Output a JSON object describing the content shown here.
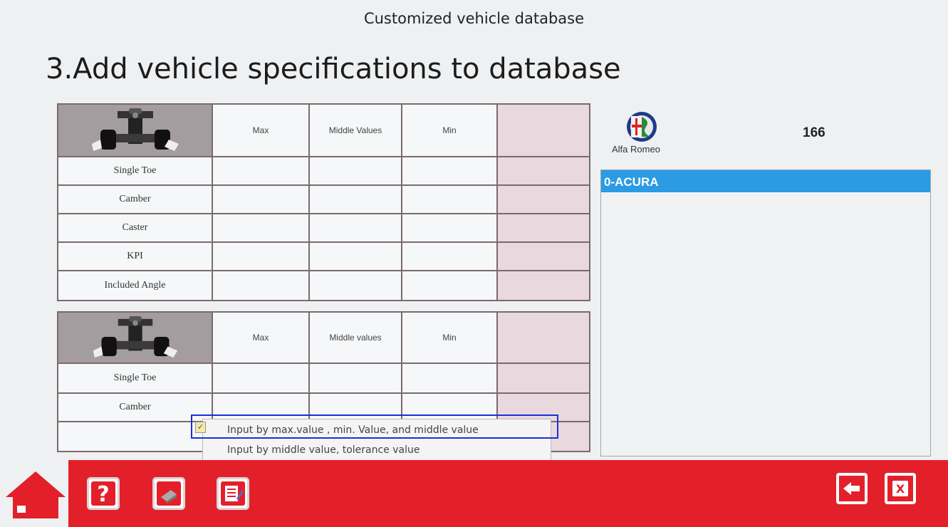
{
  "screen_title": "Customized vehicle database",
  "heading": "3.Add vehicle specifications to database",
  "front_table": {
    "headers": [
      "Max",
      "Middle Values",
      "Min"
    ],
    "rows": [
      "Single Toe",
      "Camber",
      "Caster",
      "KPI",
      "Included Angle"
    ]
  },
  "rear_table": {
    "headers": [
      "Max",
      "Middle values",
      "Min"
    ],
    "rows": [
      "Single Toe",
      "Camber",
      ""
    ]
  },
  "brand": {
    "name": "Alfa Romeo",
    "model": "166",
    "logo_icon": "alfa-romeo-logo"
  },
  "make_list": {
    "items": [
      "0-ACURA"
    ],
    "selected_color": "#2b9be3"
  },
  "input_mode_menu": {
    "options": [
      {
        "label": "Input by max.value , min. Value, and middle value",
        "checked": true
      },
      {
        "label": "Input by middle value, tolerance value",
        "checked": false
      }
    ],
    "highlight_color": "#1a2fd6"
  },
  "toolbar": {
    "icons": [
      "home-icon",
      "help-icon",
      "sensor-icon",
      "list-edit-icon",
      "back-icon",
      "close-icon"
    ],
    "bar_color": "#e3202a"
  }
}
